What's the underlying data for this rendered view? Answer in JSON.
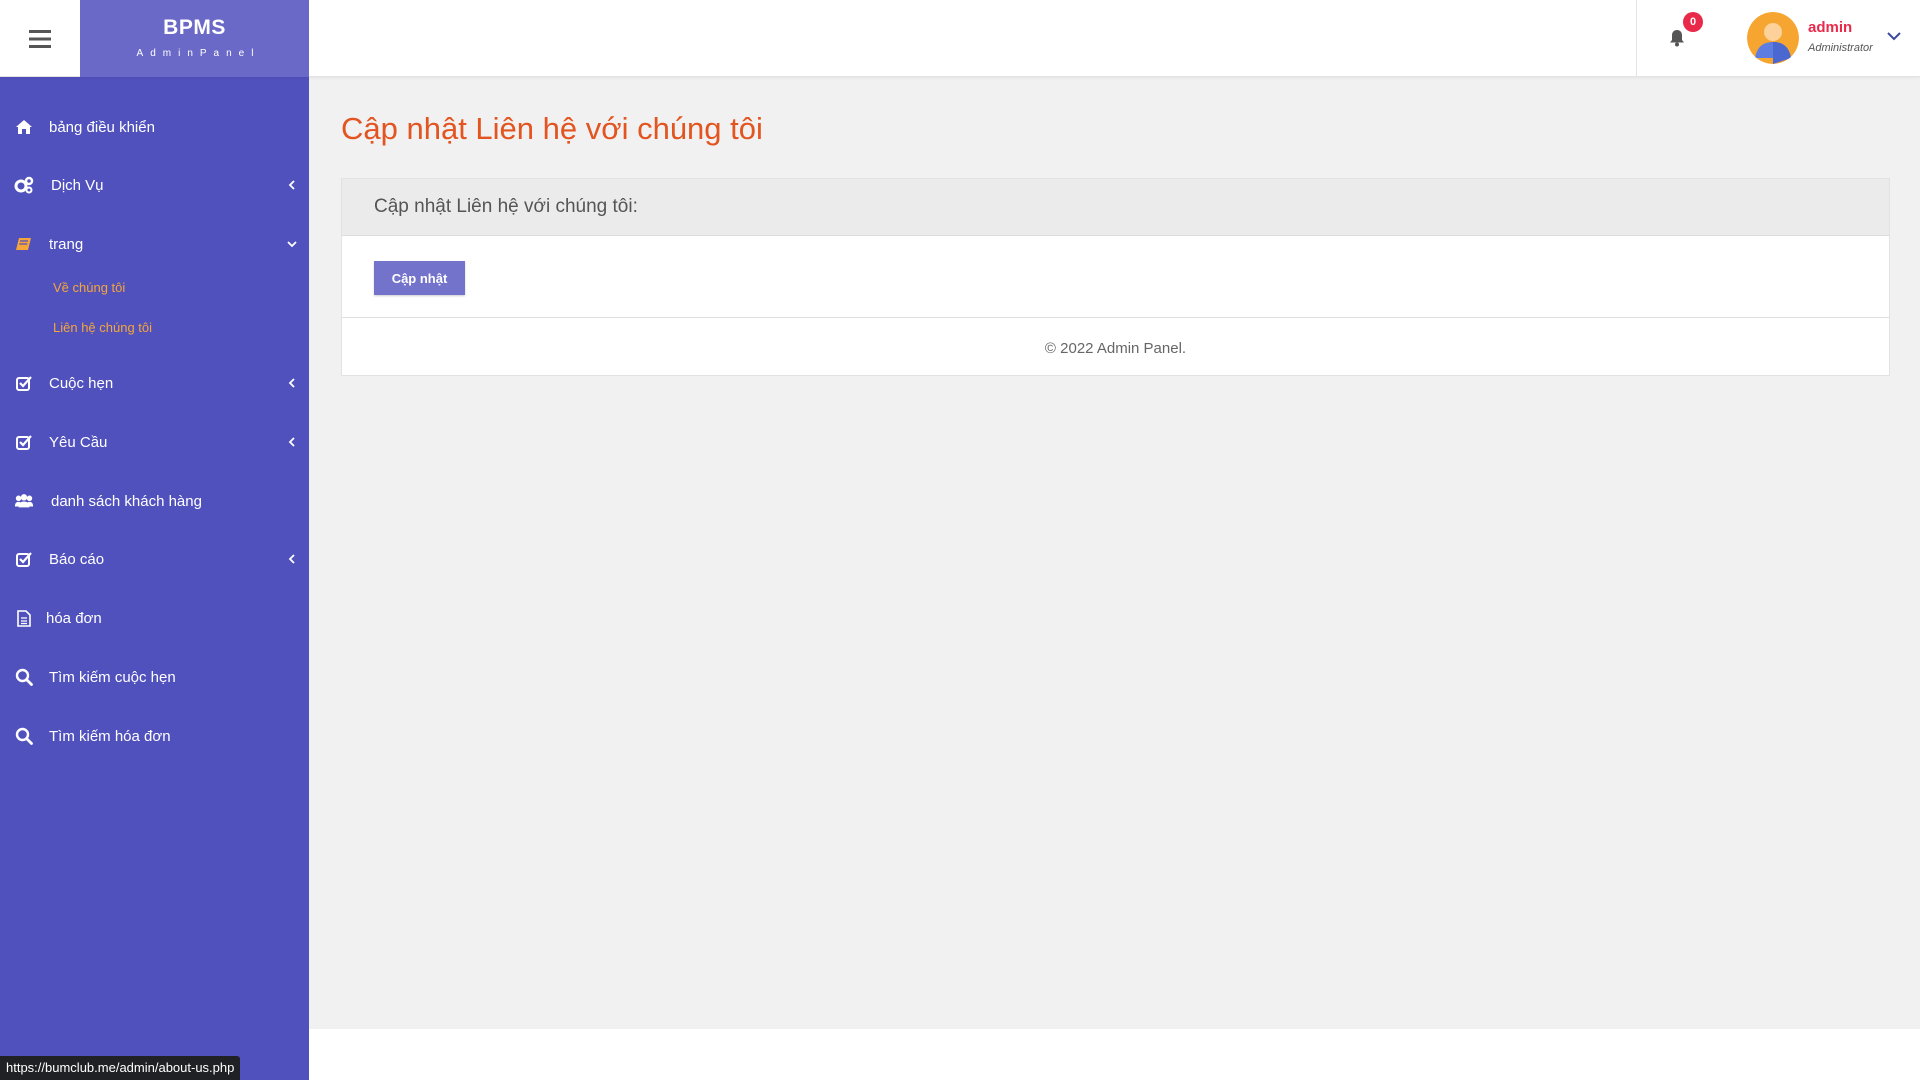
{
  "brand": {
    "title": "BPMS",
    "subtitle": "AdminPanel"
  },
  "topbar": {
    "notification_count": "0",
    "user": {
      "name": "admin",
      "role": "Administrator"
    }
  },
  "sidebar": {
    "items": [
      {
        "label": "bảng điều khiển",
        "icon": "home-icon"
      },
      {
        "label": "Dịch Vụ",
        "icon": "gears-icon"
      },
      {
        "label": "trang",
        "icon": "book-icon",
        "expanded": true,
        "sub_items": [
          {
            "label": "Về chúng tôi"
          },
          {
            "label": "Liên hệ chúng tôi"
          }
        ]
      },
      {
        "label": "Cuộc hẹn",
        "icon": "checkbox-icon"
      },
      {
        "label": "Yêu Cầu",
        "icon": "checkbox-icon"
      },
      {
        "label": "danh sách khách hàng",
        "icon": "users-icon"
      },
      {
        "label": "Báo cáo",
        "icon": "checkbox-icon"
      },
      {
        "label": "hóa đơn",
        "icon": "file-icon"
      },
      {
        "label": "Tìm kiếm cuộc hẹn",
        "icon": "search-icon"
      },
      {
        "label": "Tìm kiếm hóa đơn",
        "icon": "search-icon"
      }
    ]
  },
  "main": {
    "page_title": "Cập nhật Liên hệ với chúng tôi",
    "panel_title": "Cập nhật Liên hệ với chúng tôi:",
    "update_button": "Cập nhật",
    "copyright": "© 2022 Admin Panel."
  },
  "status_bar": {
    "url": "https://bumclub.me/admin/about-us.php"
  },
  "colors": {
    "sidebar_bg": "#5051bd",
    "brand_bg": "#6a69c8",
    "title_accent": "#e25420",
    "submenu_text": "#f5a53a",
    "badge": "#e8294a",
    "button": "#7473cc"
  }
}
